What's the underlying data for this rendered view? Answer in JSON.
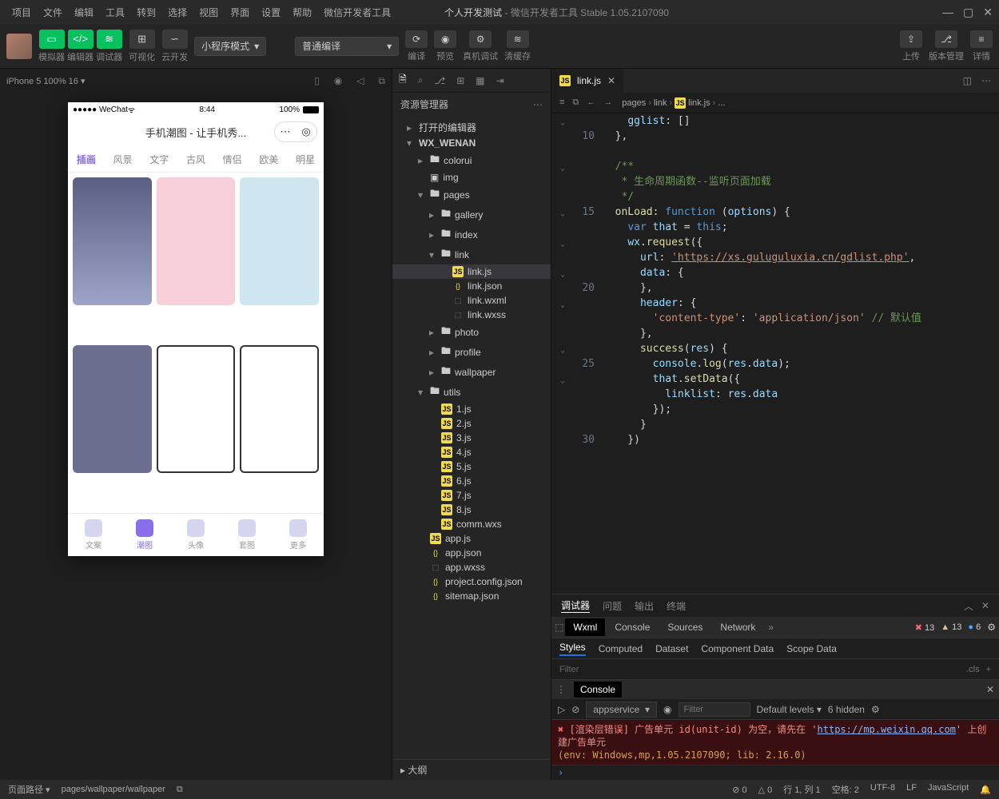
{
  "menus": [
    "项目",
    "文件",
    "编辑",
    "工具",
    "转到",
    "选择",
    "视图",
    "界面",
    "设置",
    "帮助",
    "微信开发者工具"
  ],
  "title": {
    "bold": "个人开发测试",
    "rest": " - 微信开发者工具 Stable 1.05.2107090"
  },
  "toolbar": {
    "group1_labels": "模拟器  编辑器  调试器",
    "vis_label": "可视化",
    "cloud_label": "云开发",
    "mode_select": "小程序模式",
    "compile_select": "普通编译",
    "actions": {
      "compile": "编译",
      "preview": "预览",
      "realdev": "真机调试",
      "clear": "清缓存"
    },
    "right": {
      "upload": "上传",
      "version": "版本管理",
      "details": "详情"
    }
  },
  "sim": {
    "device": "iPhone 5 100% 16 ▾",
    "wechat": "●●●●● WeChat",
    "time": "8:44",
    "batt": "100%",
    "app_title": "手机潮图 - 让手机秀...",
    "tabs": [
      "插画",
      "风景",
      "文字",
      "古风",
      "情侣",
      "欧美",
      "明星"
    ],
    "tabbar": [
      "文案",
      "潮图",
      "头像",
      "套图",
      "更多"
    ]
  },
  "explorer": {
    "title": "资源管理器",
    "opened": "打开的编辑器",
    "project": "WX_WENAN",
    "outline": "大纲",
    "tree": [
      {
        "d": 2,
        "caret": "▸",
        "cls": "ffolder",
        "txt": "colorui"
      },
      {
        "d": 2,
        "caret": "",
        "cls": "fimg",
        "txt": "img"
      },
      {
        "d": 2,
        "caret": "▾",
        "cls": "ffolder",
        "txt": "pages"
      },
      {
        "d": 3,
        "caret": "▸",
        "cls": "ffolder",
        "txt": "gallery"
      },
      {
        "d": 3,
        "caret": "▸",
        "cls": "ffolder",
        "txt": "index"
      },
      {
        "d": 3,
        "caret": "▾",
        "cls": "ffolder",
        "txt": "link"
      },
      {
        "d": 4,
        "caret": "",
        "cls": "fjs",
        "txt": "link.js",
        "sel": true,
        "ico": "JS"
      },
      {
        "d": 4,
        "caret": "",
        "cls": "fjson",
        "txt": "link.json",
        "ico": "{}"
      },
      {
        "d": 4,
        "caret": "",
        "cls": "fwxml",
        "txt": "link.wxml",
        "ico": "⬚"
      },
      {
        "d": 4,
        "caret": "",
        "cls": "fwxss",
        "txt": "link.wxss",
        "ico": "⬚"
      },
      {
        "d": 3,
        "caret": "▸",
        "cls": "ffolder",
        "txt": "photo"
      },
      {
        "d": 3,
        "caret": "▸",
        "cls": "ffolder",
        "txt": "profile"
      },
      {
        "d": 3,
        "caret": "▸",
        "cls": "ffolder",
        "txt": "wallpaper"
      },
      {
        "d": 2,
        "caret": "▾",
        "cls": "ffolder",
        "txt": "utils"
      },
      {
        "d": 3,
        "caret": "",
        "cls": "fjs",
        "txt": "1.js",
        "ico": "JS"
      },
      {
        "d": 3,
        "caret": "",
        "cls": "fjs",
        "txt": "2.js",
        "ico": "JS"
      },
      {
        "d": 3,
        "caret": "",
        "cls": "fjs",
        "txt": "3.js",
        "ico": "JS"
      },
      {
        "d": 3,
        "caret": "",
        "cls": "fjs",
        "txt": "4.js",
        "ico": "JS"
      },
      {
        "d": 3,
        "caret": "",
        "cls": "fjs",
        "txt": "5.js",
        "ico": "JS"
      },
      {
        "d": 3,
        "caret": "",
        "cls": "fjs",
        "txt": "6.js",
        "ico": "JS"
      },
      {
        "d": 3,
        "caret": "",
        "cls": "fjs",
        "txt": "7.js",
        "ico": "JS"
      },
      {
        "d": 3,
        "caret": "",
        "cls": "fjs",
        "txt": "8.js",
        "ico": "JS"
      },
      {
        "d": 3,
        "caret": "",
        "cls": "fjs",
        "txt": "comm.wxs",
        "ico": "JS"
      },
      {
        "d": 2,
        "caret": "",
        "cls": "fjs",
        "txt": "app.js",
        "ico": "JS"
      },
      {
        "d": 2,
        "caret": "",
        "cls": "fjson",
        "txt": "app.json",
        "ico": "{}"
      },
      {
        "d": 2,
        "caret": "",
        "cls": "fwxss",
        "txt": "app.wxss",
        "ico": "⬚"
      },
      {
        "d": 2,
        "caret": "",
        "cls": "fjson",
        "txt": "project.config.json",
        "ico": "{}"
      },
      {
        "d": 2,
        "caret": "",
        "cls": "fjson",
        "txt": "sitemap.json",
        "ico": "{}"
      }
    ]
  },
  "editor": {
    "tab": "link.js",
    "breadcrumb": [
      "pages",
      "link",
      "link.js",
      "..."
    ],
    "lines": [
      {
        "n": "",
        "fold": "⌄",
        "html": "    <span class='v'>gglist</span>: []"
      },
      {
        "n": "10",
        "fold": "",
        "html": "  },"
      },
      {
        "n": "",
        "fold": "",
        "html": " "
      },
      {
        "n": "",
        "fold": "⌄",
        "html": "  <span class='c'>/**</span>"
      },
      {
        "n": "",
        "fold": "",
        "html": "<span class='c'>   * 生命周期函数--监听页面加载</span>"
      },
      {
        "n": "",
        "fold": "",
        "html": "<span class='c'>   */</span>"
      },
      {
        "n": "15",
        "fold": "⌄",
        "html": "  <span class='f'>onLoad</span>: <span class='b'>function</span> (<span class='v'>options</span>) {"
      },
      {
        "n": "",
        "fold": "",
        "html": "    <span class='b'>var</span> <span class='v'>that</span> <span class='p'>=</span> <span class='b'>this</span>;"
      },
      {
        "n": "",
        "fold": "⌄",
        "html": "    <span class='v'>wx</span>.<span class='f'>request</span>({"
      },
      {
        "n": "",
        "fold": "",
        "html": "      <span class='v'>url</span>: <span class='s u'>'https://xs.guluguluxia.cn/gdlist.php'</span>,"
      },
      {
        "n": "",
        "fold": "⌄",
        "html": "      <span class='v'>data</span>: {"
      },
      {
        "n": "20",
        "fold": "",
        "html": "      },"
      },
      {
        "n": "",
        "fold": "⌄",
        "html": "      <span class='v'>header</span>: {"
      },
      {
        "n": "",
        "fold": "",
        "html": "        <span class='s'>'content-type'</span>: <span class='s'>'application/json'</span> <span class='c'>// 默认值</span>"
      },
      {
        "n": "",
        "fold": "",
        "html": "      },"
      },
      {
        "n": "",
        "fold": "⌄",
        "html": "      <span class='f'>success</span>(<span class='v'>res</span>) {"
      },
      {
        "n": "25",
        "fold": "",
        "html": "        <span class='v'>console</span>.<span class='f'>log</span>(<span class='v'>res</span>.<span class='v'>data</span>);"
      },
      {
        "n": "",
        "fold": "⌄",
        "html": "        <span class='v'>that</span>.<span class='f'>setData</span>({"
      },
      {
        "n": "",
        "fold": "",
        "html": "          <span class='v'>linklist</span>: <span class='v'>res</span>.<span class='v'>data</span>"
      },
      {
        "n": "",
        "fold": "",
        "html": "        });"
      },
      {
        "n": "",
        "fold": "",
        "html": "      }"
      },
      {
        "n": "30",
        "fold": "",
        "html": "    })"
      }
    ]
  },
  "debug": {
    "panel_tabs": [
      "调试器",
      "问题",
      "输出",
      "终端"
    ],
    "dt_tabs": [
      "Wxml",
      "Console",
      "Sources",
      "Network"
    ],
    "badges": {
      "err": "13",
      "warn": "13",
      "info": "6"
    },
    "style_tabs": [
      "Styles",
      "Computed",
      "Dataset",
      "Component Data",
      "Scope Data"
    ],
    "filter_ph": "Filter",
    "cls": ".cls"
  },
  "console": {
    "label": "Console",
    "ctx": "appservice",
    "filter_ph": "Filter",
    "level": "Default levels ▾",
    "hidden": "6 hidden",
    "err1": "[渲染层错误] 广告单元 id(unit-id) 为空，请先在 '",
    "err_link": "https://mp.weixin.qq.com",
    "err2": "' 上创建广告单元",
    "env": "(env: Windows,mp,1.05.2107090; lib: 2.16.0)"
  },
  "status": {
    "left1": "页面路径 ▾",
    "left2": "pages/wallpaper/wallpaper",
    "errwarn_e": "⊘ 0",
    "errwarn_w": "△ 0",
    "r": [
      "行 1, 列 1",
      "空格: 2",
      "UTF-8",
      "LF",
      "JavaScript"
    ]
  }
}
